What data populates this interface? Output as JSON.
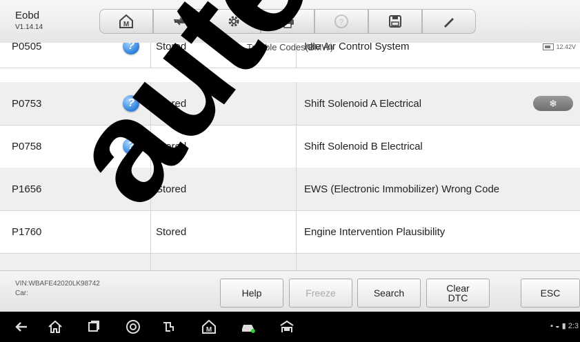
{
  "app": {
    "name": "Eobd",
    "version": "V1.14.14"
  },
  "toolbar": {
    "buttons": [
      {
        "name": "home-icon"
      },
      {
        "name": "vehicle-swap-icon"
      },
      {
        "name": "settings-gear-icon"
      },
      {
        "name": "print-icon"
      },
      {
        "name": "help-circle-icon"
      },
      {
        "name": "save-icon"
      },
      {
        "name": "pen-icon"
      }
    ]
  },
  "header": {
    "title": "Trouble Codes(BMW)",
    "battery_voltage": "12.42V"
  },
  "dtc_rows": [
    {
      "code": "P0505",
      "status": "Stored",
      "description": "Idle Air Control System",
      "has_help": true
    },
    {
      "code": "P0753",
      "status": "Stored",
      "description": "Shift Solenoid A Electrical",
      "has_help": true,
      "freeze_icon": "snowflake-icon"
    },
    {
      "code": "P0758",
      "status": "Stored",
      "description": "Shift Solenoid B Electrical",
      "has_help": true
    },
    {
      "code": "P1656",
      "status": "Stored",
      "description": "EWS (Electronic Immobilizer) Wrong Code",
      "has_help": false
    },
    {
      "code": "P1760",
      "status": "Stored",
      "description": "Engine Intervention Plausibility",
      "has_help": false
    }
  ],
  "footer": {
    "vin_label": "VIN:WBAFE42020LK98742",
    "car_label": "Car:",
    "help": "Help",
    "freeze": "Freeze",
    "search": "Search",
    "clear_line1": "Clear",
    "clear_line2": "DTC",
    "esc": "ESC"
  },
  "statusbar": {
    "time": "2:3"
  },
  "watermark": "autel"
}
